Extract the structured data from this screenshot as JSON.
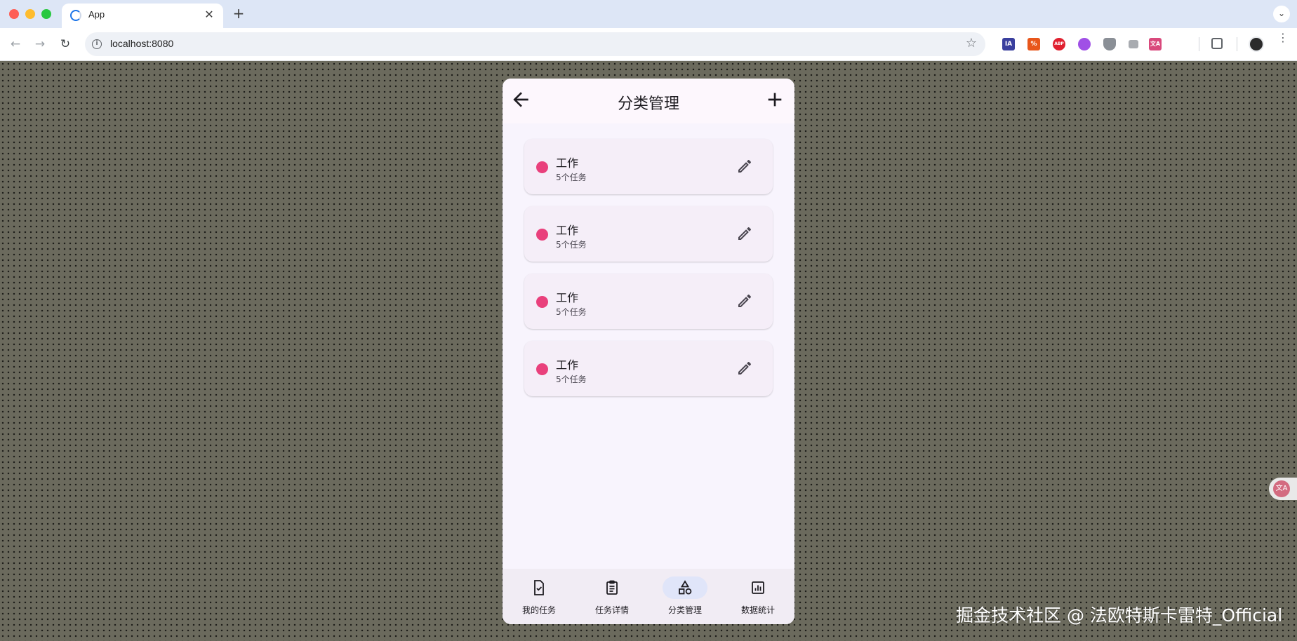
{
  "browser": {
    "tab_title": "App",
    "tab_close": "✕",
    "new_tab": "+",
    "tab_menu": "⌄",
    "url": "localhost:8080",
    "extensions": [
      "IA",
      "%",
      "ABP",
      "",
      "",
      "",
      "文A",
      ""
    ]
  },
  "app": {
    "title": "分类管理",
    "categories": [
      {
        "name": "工作",
        "count_text": "5个任务",
        "color": "#e9407c"
      },
      {
        "name": "工作",
        "count_text": "5个任务",
        "color": "#e9407c"
      },
      {
        "name": "工作",
        "count_text": "5个任务",
        "color": "#e9407c"
      },
      {
        "name": "工作",
        "count_text": "5个任务",
        "color": "#e9407c"
      }
    ],
    "bottom_nav": [
      {
        "label": "我的任务",
        "icon": "task-check-icon",
        "active": false
      },
      {
        "label": "任务详情",
        "icon": "clipboard-icon",
        "active": false
      },
      {
        "label": "分类管理",
        "icon": "category-shapes-icon",
        "active": true
      },
      {
        "label": "数据统计",
        "icon": "chart-icon",
        "active": false
      }
    ]
  },
  "side_float_label": "文A",
  "watermark": "掘金技术社区 @ 法欧特斯卡雷特_Official",
  "colors": {
    "accent": "#e9407c",
    "nav_active_pill": "#e0e5f9",
    "page_background": "#6b6a5d"
  }
}
